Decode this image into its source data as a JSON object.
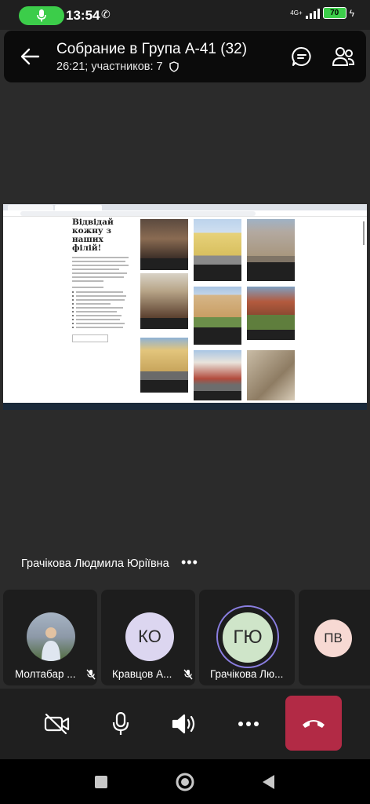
{
  "status_bar": {
    "time": "13:54",
    "network": "4G+",
    "battery": "70"
  },
  "header": {
    "title": "Собрание в Група А-41 (32)",
    "subtitle": "26:21; участников: 7"
  },
  "shared_screen": {
    "heading": "Відвідай кожну з наших філій!",
    "cards": [
      {
        "image": "museum-interior"
      },
      {
        "image": "yellow-mansion"
      },
      {
        "image": "victorian-house"
      },
      {
        "image": "room-interior"
      },
      {
        "image": "classical-building"
      },
      {
        "image": "red-brick-house"
      },
      {
        "image": "yellow-building"
      },
      {
        "image": "white-building"
      },
      {
        "image": "manuscript"
      }
    ]
  },
  "speaker": {
    "name": "Грачікова Людмила Юріївна"
  },
  "participants": [
    {
      "name": "Молтабар ...",
      "avatar_type": "photo",
      "muted": true
    },
    {
      "name": "Кравцов А...",
      "initials": "КО",
      "avatar_color": "#dcd6f0",
      "muted": true
    },
    {
      "name": "Грачікова Лю...",
      "initials": "ГЮ",
      "avatar_color": "#cfe5c9",
      "muted": false
    },
    {
      "name": "",
      "initials": "ПВ",
      "avatar_color": "#f7d9d3",
      "muted": false
    }
  ],
  "colors": {
    "end_call": "#b22a45",
    "mic_pill": "#3ccd4a"
  }
}
